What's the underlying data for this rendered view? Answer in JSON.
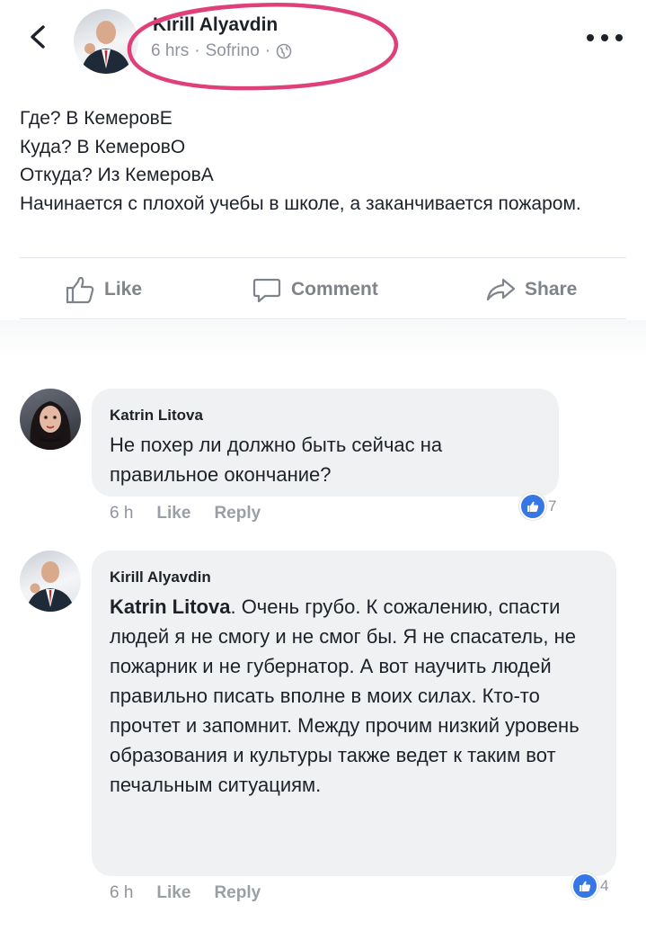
{
  "post": {
    "author": "Kirill Alyavdin",
    "time": "6 hrs",
    "separator": "·",
    "location": "Sofrino",
    "visibility_icon": "globe-icon",
    "lines": [
      "Где? В КемеровЕ",
      "Куда? В КемеровО",
      "Откуда? Из КемеровА",
      "Начинается с плохой учебы в школе, а заканчивается пожаром."
    ]
  },
  "actions": {
    "like": "Like",
    "comment": "Comment",
    "share": "Share"
  },
  "comments": [
    {
      "author": "Katrin Litova",
      "text": "Не похер ли должно быть сейчас на правильное окончание?",
      "time": "6 h",
      "like_label": "Like",
      "reply_label": "Reply",
      "reactions": "7"
    },
    {
      "author": "Kirill Alyavdin",
      "mention": "Katrin Litova",
      "text": ". Очень грубо. К сожалению, спасти людей я не смогу и не смог бы. Я не спасатель, не пожарник и не губернатор. А вот научить людей правильно писать вполне в моих силах. Кто-то прочтет и запомнит. Между прочим низкий уровень образования и культуры также ведет к таким вот печальным ситуациям.",
      "time": "6 h",
      "like_label": "Like",
      "reply_label": "Reply",
      "reactions": "4"
    }
  ],
  "colors": {
    "accent": "#3578e5",
    "highlight": "#e0407a",
    "muted": "#90949c",
    "bubble": "#eff1f3"
  }
}
